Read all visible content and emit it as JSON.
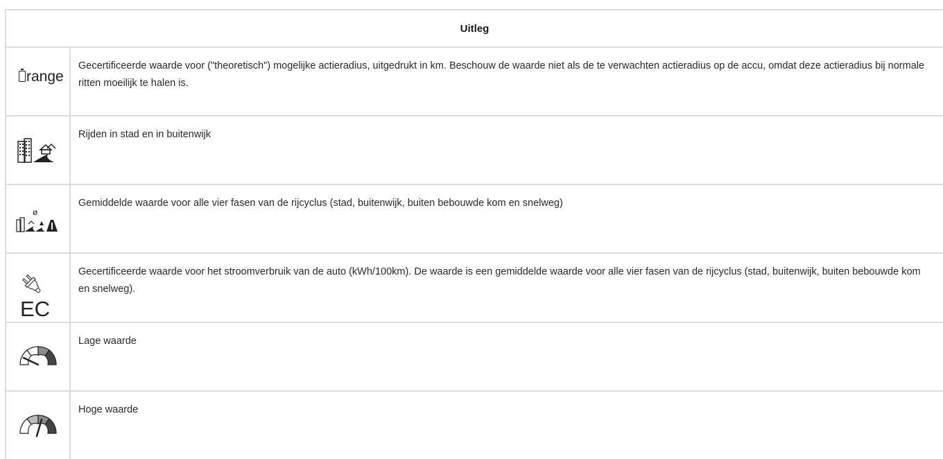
{
  "header": {
    "title": "Uitleg"
  },
  "rows": [
    {
      "icon": "battery-range-icon",
      "icon_text": "range",
      "text": "Gecertificeerde waarde voor (\"theoretisch\") mogelijke actieradius, uitgedrukt in km. Beschouw de waarde niet als de te verwachten actieradius op de accu, omdat deze actieradius bij normale ritten moeilijk te halen is."
    },
    {
      "icon": "city-suburb-icon",
      "text": "Rijden in stad en in buitenwijk"
    },
    {
      "icon": "average-all-phases-icon",
      "icon_text": "ø",
      "text": "Gemiddelde waarde voor alle vier fasen van de rijcyclus (stad, buitenwijk, buiten bebouwde kom en snelweg)"
    },
    {
      "icon": "plug-ec-icon",
      "icon_text": "EC",
      "text": "Gecertificeerde waarde voor het stroomverbruik van de auto (kWh/100km). De waarde is een gemiddelde waarde voor alle vier fasen van de rijcyclus (stad, buitenwijk, buiten bebouwde kom en snelweg)."
    },
    {
      "icon": "gauge-low-icon",
      "gauge_level": 0.1,
      "text": "Lage waarde"
    },
    {
      "icon": "gauge-high-icon",
      "gauge_level": 0.6,
      "text": "Hoge waarde"
    }
  ]
}
